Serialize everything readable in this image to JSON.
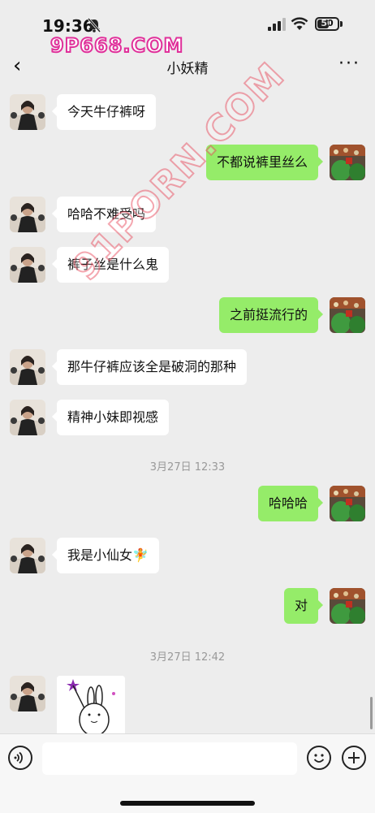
{
  "status_bar": {
    "time": "19:36",
    "battery": "50"
  },
  "watermark": {
    "top": "9P668.COM",
    "diagonal": "91PORN.COM"
  },
  "nav": {
    "back_glyph": "‹",
    "title": "小妖精",
    "more_glyph": "···"
  },
  "messages": [
    {
      "side": "left",
      "text": "今天牛仔裤呀"
    },
    {
      "side": "right",
      "text": "不都说裤里丝么"
    },
    {
      "side": "left",
      "text": "哈哈不难受吗"
    },
    {
      "side": "left",
      "text": "裤子丝是什么鬼"
    },
    {
      "side": "right",
      "text": "之前挺流行的"
    },
    {
      "side": "left",
      "text": "那牛仔裤应该全是破洞的那种"
    },
    {
      "side": "left",
      "text": "精神小妹即视感"
    },
    {
      "type": "time",
      "text": "3月27日 12:33"
    },
    {
      "side": "right",
      "text": "哈哈哈"
    },
    {
      "side": "left",
      "text": "我是小仙女🧚"
    },
    {
      "side": "right",
      "text": "对"
    },
    {
      "type": "time",
      "text": "3月27日 12:42"
    },
    {
      "side": "left",
      "type": "sticker",
      "sticker": "rabbit-wand-sticker"
    }
  ],
  "input": {
    "placeholder": "",
    "value": ""
  },
  "icons": {
    "voice": "voice-icon",
    "emoji": "emoji-icon",
    "plus": "plus-icon",
    "back": "back-icon",
    "more": "more-icon"
  },
  "colors": {
    "self_bubble": "#95ec69",
    "other_bubble": "#ffffff",
    "background": "#ededed"
  }
}
